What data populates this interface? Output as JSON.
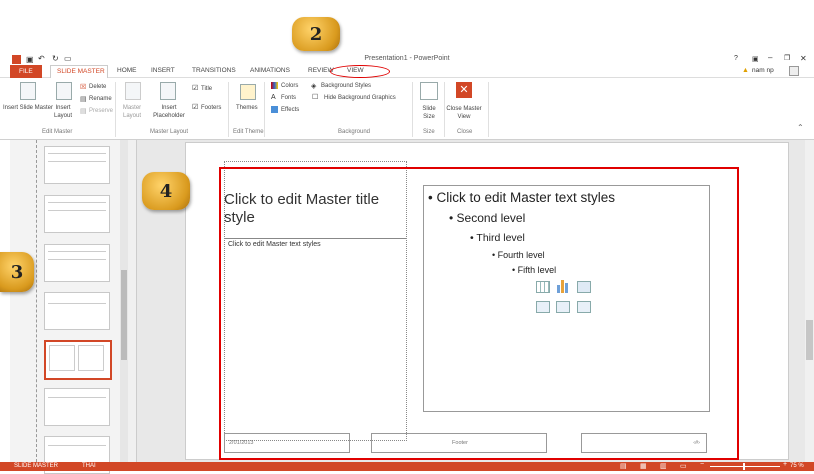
{
  "window": {
    "title": "Presentation1 - PowerPoint",
    "help": "?",
    "user": "nam np"
  },
  "tabs": [
    {
      "label": "FILE"
    },
    {
      "label": "SLIDE MASTER"
    },
    {
      "label": "HOME"
    },
    {
      "label": "INSERT"
    },
    {
      "label": "TRANSITIONS"
    },
    {
      "label": "ANIMATIONS"
    },
    {
      "label": "REVIEW"
    },
    {
      "label": "VIEW"
    }
  ],
  "ribbon": {
    "insert_slide_master": "Insert Slide Master",
    "insert_layout": "Insert Layout",
    "delete": "Delete",
    "rename": "Rename",
    "preserve": "Preserve",
    "master_layout": "Master Layout",
    "insert_placeholder": "Insert Placeholder",
    "title_check": "Title",
    "footers_check": "Footers",
    "themes": "Themes",
    "colors": "Colors",
    "fonts": "Fonts",
    "effects": "Effects",
    "background_styles": "Background Styles",
    "hide_background_graphics": "Hide Background Graphics",
    "slide_size": "Slide Size",
    "close_master_view": "Close Master View",
    "groups": {
      "edit_master": "Edit Master",
      "master_layout": "Master Layout",
      "edit_theme": "Edit Theme",
      "background": "Background",
      "size": "Size",
      "close": "Close"
    }
  },
  "slide": {
    "title": "Click to edit Master title style",
    "left_text": "Click to edit Master text styles",
    "levels": [
      "Click to edit Master text styles",
      "Second level",
      "Third level",
      "Fourth level",
      "Fifth level"
    ],
    "date": "2/01/2013",
    "footer": "Footer",
    "page": "‹#›"
  },
  "status": {
    "mode": "SLIDE MASTER",
    "language": "THAI",
    "zoom": "75 %"
  },
  "callouts": [
    "2",
    "3",
    "4"
  ],
  "colors": {
    "accent": "#d24726",
    "highlight": "#e00000"
  }
}
